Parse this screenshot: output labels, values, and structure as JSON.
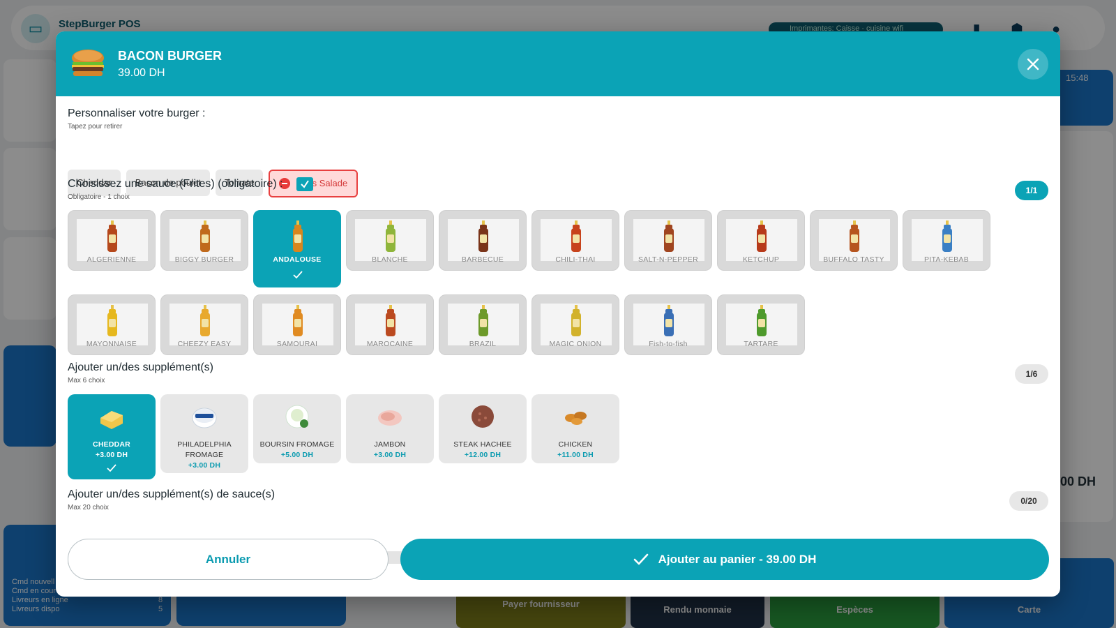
{
  "app": {
    "name": "StepBurger POS",
    "printer_status": "Imprimantes:  Caisse  · cuisine wifi",
    "clock": "15:48",
    "total_peek": "0.00 DH",
    "bottom_tiles": [
      "Payer fournisseur",
      "Rendu monnaie",
      "Espèces",
      "Carte"
    ],
    "side_stats": [
      "Cmd nouvell",
      "Cmd en cour",
      "Livreurs en ligne",
      "Livreurs dispo"
    ],
    "side_stats_values": [
      "8",
      "5"
    ]
  },
  "modal": {
    "title": "BACON BURGER",
    "price": "39.00 DH",
    "customize": {
      "title": "Personnaliser votre burger :",
      "subtitle": "Tapez pour retirer",
      "chips": [
        "Cheddar",
        "Bacon de poulet",
        "Tomate"
      ],
      "removed_chip": "Sans Salade"
    },
    "sauce": {
      "title": "Choisissez une sauce (Frites) (obligatoire) :",
      "subtitle": "Obligatoire - 1 choix",
      "badge": "1/1",
      "row1": [
        "ALGERIENNE",
        "BIGGY BURGER",
        "ANDALOUSE",
        "BLANCHE",
        "BARBECUE",
        "CHILI-THAI",
        "SALT-N-PEPPER",
        "KETCHUP",
        "BUFFALO TASTY",
        "PITA-KEBAB"
      ],
      "row2": [
        "MAYONNAISE",
        "CHEEZY EASY",
        "SAMOURAI",
        "MAROCAINE",
        "BRAZIL",
        "MAGIC ONION",
        "Fish-to-fish",
        "TARTARE"
      ],
      "selected": "ANDALOUSE"
    },
    "supplements": {
      "title": "Ajouter un/des supplément(s)",
      "subtitle": "Max 6 choix",
      "badge": "1/6",
      "items": [
        {
          "name": "CHEDDAR",
          "price": "+3.00 DH"
        },
        {
          "name": "PHILADELPHIA FROMAGE",
          "price": "+3.00 DH"
        },
        {
          "name": "BOURSIN FROMAGE",
          "price": "+5.00 DH"
        },
        {
          "name": "JAMBON",
          "price": "+3.00 DH"
        },
        {
          "name": "STEAK HACHEE",
          "price": "+12.00 DH"
        },
        {
          "name": "CHICKEN",
          "price": "+11.00 DH"
        }
      ]
    },
    "sauce_supplements": {
      "title": "Ajouter un/des supplément(s) de sauce(s)",
      "subtitle": "Max 20 choix",
      "badge": "0/20"
    },
    "footer": {
      "cancel": "Annuler",
      "add": "Ajouter au panier - 39.00 DH"
    }
  },
  "colors": {
    "accent": "#0ba3b6",
    "danger": "#e84040"
  }
}
